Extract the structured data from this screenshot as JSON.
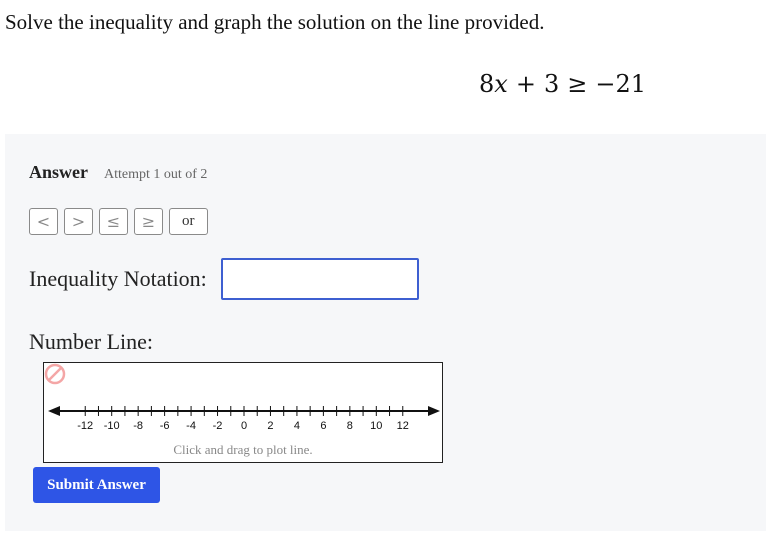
{
  "question": {
    "prompt": "Solve the inequality and graph the solution on the line provided.",
    "equation": {
      "coef": "8",
      "var": "x",
      "op": "+",
      "const": "3",
      "relation": "≥",
      "rhs": "−21"
    }
  },
  "answer": {
    "title": "Answer",
    "attempt": "Attempt 1 out of 2",
    "symbol_buttons": [
      "<",
      ">",
      "≤",
      "≥",
      "or"
    ],
    "inequality_label": "Inequality Notation:",
    "inequality_value": "",
    "number_line_label": "Number Line:",
    "number_line": {
      "min": -13,
      "max": 13,
      "ticks": [
        -12,
        -11,
        -10,
        -9,
        -8,
        -7,
        -6,
        -5,
        -4,
        -3,
        -2,
        -1,
        0,
        1,
        2,
        3,
        4,
        5,
        6,
        7,
        8,
        9,
        10,
        11,
        12
      ],
      "labels": [
        "-12",
        "-10",
        "-8",
        "-6",
        "-4",
        "-2",
        "0",
        "2",
        "4",
        "6",
        "8",
        "10",
        "12"
      ],
      "hint": "Click and drag to plot line."
    },
    "submit_label": "Submit Answer",
    "colors": {
      "accent": "#2e55e6",
      "input_border": "#3e5fd1",
      "clear_icon": "#f4a6a6"
    },
    "icons": {
      "clear": "clear-icon"
    }
  }
}
